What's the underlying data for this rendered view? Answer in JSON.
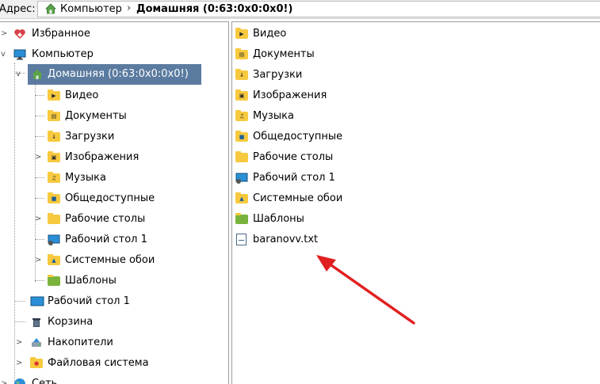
{
  "address": {
    "label": "Адрес:",
    "crumbs": [
      "Компьютер",
      "Домашняя (0:63:0x0:0x0!)"
    ],
    "separator": "›"
  },
  "tree": {
    "favorites": "Избранное",
    "computer": "Компьютер",
    "home": "Домашняя (0:63:0x0:0x0!)",
    "home_children": [
      "Видео",
      "Документы",
      "Загрузки",
      "Изображения",
      "Музыка",
      "Общедоступные",
      "Рабочие столы",
      "Рабочий стол 1",
      "Системные обои",
      "Шаблоны"
    ],
    "desktop1": "Рабочий стол 1",
    "trash": "Корзина",
    "drives": "Накопители",
    "filesystem": "Файловая система",
    "network": "Сеть"
  },
  "files": {
    "items": [
      "Видео",
      "Документы",
      "Загрузки",
      "Изображения",
      "Музыка",
      "Общедоступные",
      "Рабочие столы",
      "Рабочий стол 1",
      "Системные обои",
      "Шаблоны",
      "baranovv.txt"
    ]
  },
  "annotation": {
    "arrow_color": "#e02020"
  }
}
